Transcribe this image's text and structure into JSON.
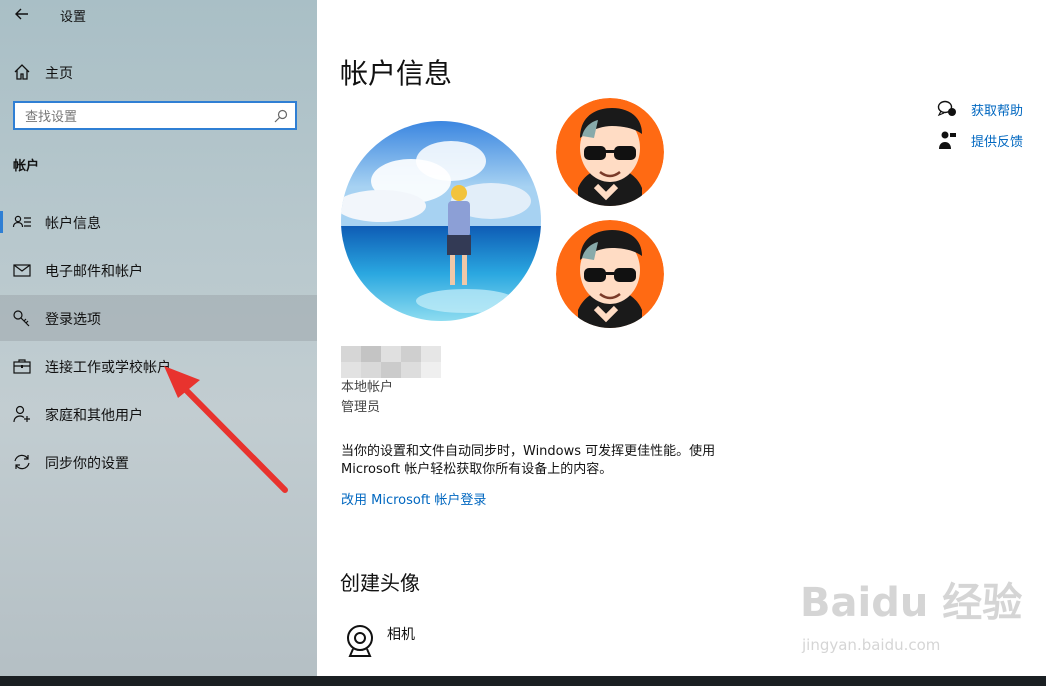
{
  "app": {
    "title": "设置"
  },
  "sidebar": {
    "home_label": "主页",
    "search": {
      "placeholder": "查找设置"
    },
    "section_title": "帐户",
    "items": [
      {
        "label": "帐户信息",
        "icon": "account-info-icon",
        "selected": true
      },
      {
        "label": "电子邮件和帐户",
        "icon": "mail-icon"
      },
      {
        "label": "登录选项",
        "icon": "key-icon"
      },
      {
        "label": "连接工作或学校帐户",
        "icon": "briefcase-icon"
      },
      {
        "label": "家庭和其他用户",
        "icon": "person-add-icon"
      },
      {
        "label": "同步你的设置",
        "icon": "sync-icon"
      }
    ]
  },
  "main": {
    "title": "帐户信息",
    "help": [
      {
        "label": "获取帮助",
        "icon": "chat-help-icon"
      },
      {
        "label": "提供反馈",
        "icon": "feedback-icon"
      }
    ],
    "account_type": "本地帐户",
    "role": "管理员",
    "description": "当你的设置和文件自动同步时，Windows 可发挥更佳性能。使用 Microsoft 帐户轻松获取你所有设备上的内容。",
    "ms_link": "改用 Microsoft 帐户登录",
    "create_avatar_title": "创建头像",
    "camera_label": "相机"
  },
  "watermark": {
    "brand": "Baidu 经验",
    "url": "jingyan.baidu.com"
  },
  "colors": {
    "accent": "#0067c0",
    "focus": "#2f7fd4",
    "arrow": "#e8332e",
    "avatar_bg": "#ff6a13"
  }
}
